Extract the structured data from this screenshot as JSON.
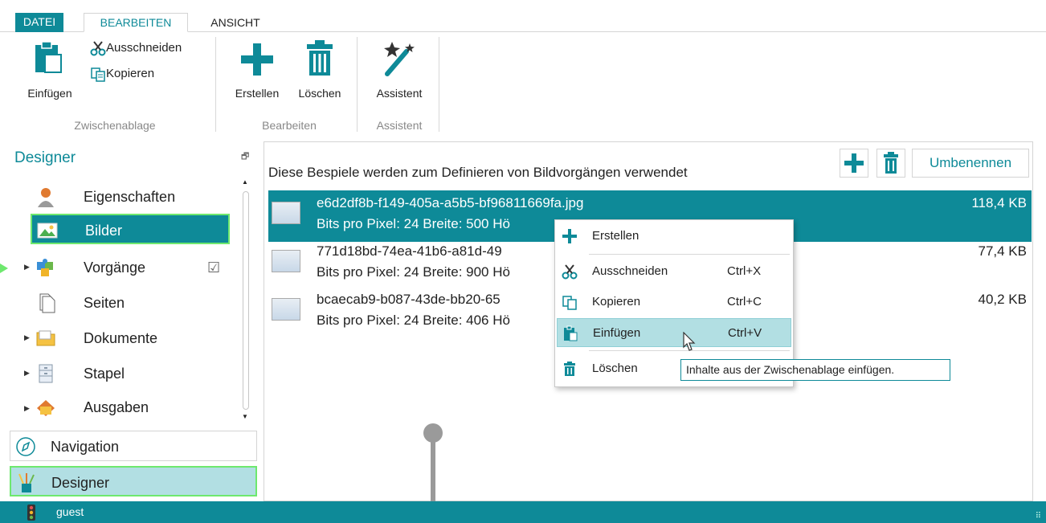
{
  "ribbon_tabs": {
    "datei": "DATEI",
    "bearbeiten": "BEARBEITEN",
    "ansicht": "ANSICHT"
  },
  "ribbon": {
    "paste_label": "Einfügen",
    "cut_label": "Ausschneiden",
    "copy_label": "Kopieren",
    "clipboard_group": "Zwischenablage",
    "create_label": "Erstellen",
    "delete_label": "Löschen",
    "edit_group": "Bearbeiten",
    "wizard_label": "Assistent",
    "wizard_group": "Assistent"
  },
  "left_panel": {
    "title": "Designer",
    "restore_glyph": "🗗",
    "items": [
      {
        "label": "Eigenschaften",
        "icon": "properties-icon"
      },
      {
        "label": "Bilder",
        "icon": "images-icon"
      },
      {
        "label": "Vorgänge",
        "icon": "puzzle-icon",
        "checkbox": "☑"
      },
      {
        "label": "Seiten",
        "icon": "pages-icon"
      },
      {
        "label": "Dokumente",
        "icon": "folder-icon"
      },
      {
        "label": "Stapel",
        "icon": "cabinet-icon"
      },
      {
        "label": "Ausgaben",
        "icon": "output-icon"
      }
    ],
    "nav_navigation": "Navigation",
    "nav_designer": "Designer"
  },
  "content": {
    "description": "Diese Bespiele werden zum Definieren von Bildvorgängen verwendet",
    "rename_button": "Umbenennen",
    "rows": [
      {
        "name": "e6d2df8b-f149-405a-a5b5-bf96811669fa.jpg",
        "meta": "Bits pro Pixel: 24 Breite: 500 Hö",
        "size": "118,4 KB"
      },
      {
        "name": "771d18bd-74ea-41b6-a81d-49",
        "meta": "Bits pro Pixel: 24 Breite: 900 Hö",
        "size": "77,4 KB"
      },
      {
        "name": "bcaecab9-b087-43de-bb20-65",
        "meta": "Bits pro Pixel: 24 Breite: 406 Hö",
        "size": "40,2 KB"
      }
    ]
  },
  "context_menu": {
    "create": "Erstellen",
    "cut": "Ausschneiden",
    "cut_shortcut": "Ctrl+X",
    "copy": "Kopieren",
    "copy_shortcut": "Ctrl+C",
    "paste": "Einfügen",
    "paste_shortcut": "Ctrl+V",
    "delete": "Löschen"
  },
  "tooltip": "Inhalte aus der Zwischenablage einfügen.",
  "status_bar": {
    "user": "guest"
  },
  "colors": {
    "accent": "#0e8a98",
    "highlight": "#b2dfe3",
    "annotation_green": "#6ee86e"
  }
}
